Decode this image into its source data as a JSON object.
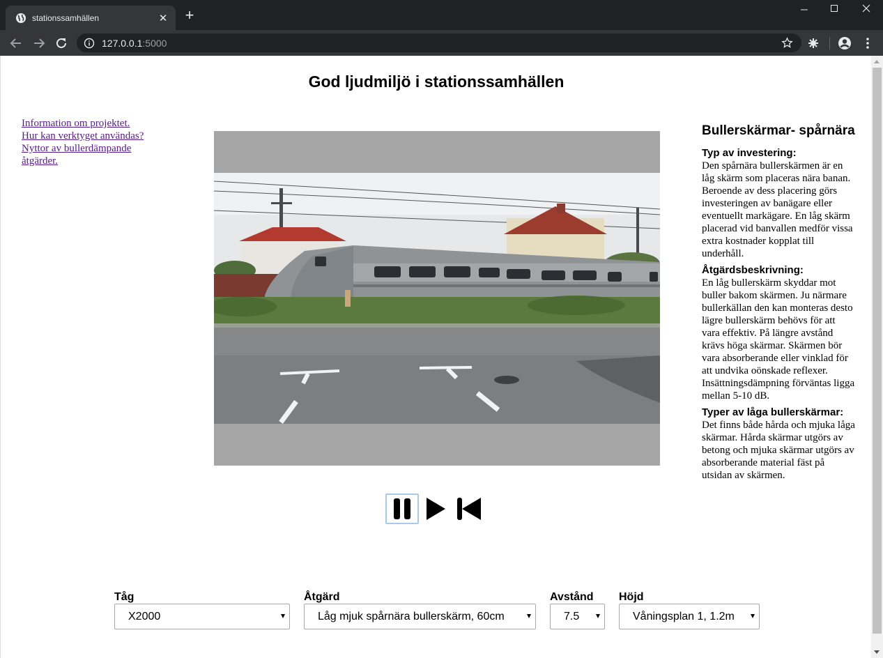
{
  "browser": {
    "tab_title": "stationssamhällen",
    "url_host": "127.0.0.1",
    "url_port": ":5000"
  },
  "page": {
    "title": "God ljudmiljö i stationssamhällen",
    "links": [
      "Information om projektet.",
      "Hur kan verktyget användas?",
      "Nyttor av bullerdämpande åtgärder."
    ]
  },
  "video": {
    "controls": [
      "pause",
      "play",
      "restart"
    ]
  },
  "info_panel": {
    "heading": "Bullerskärmar- spårnära",
    "sections": [
      {
        "title": "Typ av investering:",
        "text": "Den spårnära bullerskärmen är en låg skärm som placeras nära banan. Beroende av dess placering görs investeringen av banägare eller eventuellt markägare. En låg skärm placerad vid banvallen medför vissa extra kostnader kopplat till underhåll."
      },
      {
        "title": "Åtgärdsbeskrivning:",
        "text": "En låg bullerskärm skyddar mot buller bakom skärmen. Ju närmare bullerkällan den kan monteras desto lägre bullerskärm behövs för att vara effektiv. På längre avstånd krävs höga skärmar. Skärmen bör vara absorberande eller vinklad för att undvika oönskade reflexer. Insättningsdämpning förväntas ligga mellan 5-10 dB."
      },
      {
        "title": "Typer av låga bullerskärmar:",
        "text": "Det finns både hårda och mjuka låga skärmar. Hårda skärmar utgörs av betong och mjuka skärmar utgörs av absorberande material fäst på utsidan av skärmen."
      }
    ]
  },
  "selectors": [
    {
      "label": "Tåg",
      "value": "X2000"
    },
    {
      "label": "Åtgärd",
      "value": "Låg mjuk spårnära bullerskärm, 60cm"
    },
    {
      "label": "Avstånd",
      "value": "7.5"
    },
    {
      "label": "Höjd",
      "value": "Våningsplan 1, 1.2m"
    }
  ]
}
